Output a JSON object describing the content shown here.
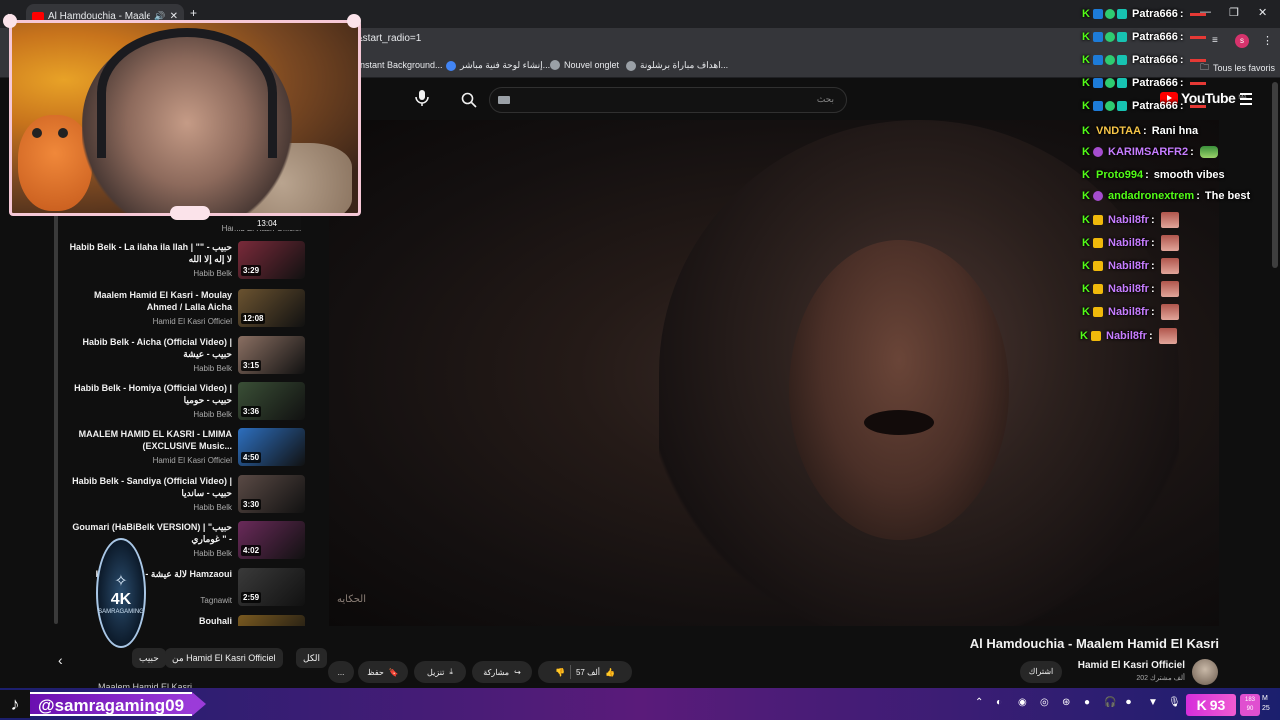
{
  "browser": {
    "tab_title": "Al Hamdouchia - Maalem H",
    "url": "&start_radio=1",
    "bookmarks": [
      {
        "label": "nstant Background..."
      },
      {
        "label": "إنشاء لوحة فنية مباشر..."
      },
      {
        "label": "Nouvel onglet"
      },
      {
        "label": "اهداف مباراة برشلونة..."
      }
    ],
    "all_favorites": "Tous les favoris",
    "profile_initial": "s"
  },
  "youtube": {
    "logo_text": "YouTube",
    "logo_region": "MA",
    "search_placeholder": "بحث"
  },
  "video": {
    "title": "Al Hamdouchia - Maalem Hamid El Kasri",
    "watermark": "الحكايه",
    "channel": "Hamid El Kasri Officiel",
    "subscribers": "202 ألف مشترك",
    "subscribe_label": "اشتراك",
    "likes": "57 ألف",
    "share_label": "مشاركة",
    "download_label": "تنزيل",
    "save_label": "حفظ",
    "more_label": "..."
  },
  "chips": {
    "c1": "الكل",
    "c2": "من Hamid El Kasri Officiel",
    "c3": "حبيب"
  },
  "playlist": {
    "first_channel": "Hamid El Kasri Officiel",
    "first_duration": "13:04",
    "items": [
      {
        "title": "Habib Belk - La ilaha ila llah | \"حبيب - \" لا إله إلا الله",
        "channel": "Habib Belk",
        "duration": "3:29",
        "color": "#7a2a3a"
      },
      {
        "title": "Maalem Hamid El Kasri - Moulay Ahmed / Lalla Aicha",
        "channel": "Hamid El Kasri Officiel",
        "duration": "12:08",
        "color": "#6b5330"
      },
      {
        "title": "Habib Belk - Aicha (Official Video) | حبيب - عيشة",
        "channel": "Habib Belk",
        "duration": "3:15",
        "color": "#8a6f62"
      },
      {
        "title": "Habib Belk - Homiya (Official Video) | حبيب - حوميا",
        "channel": "Habib Belk",
        "duration": "3:36",
        "color": "#3a4f36"
      },
      {
        "title": "MAALEM HAMID EL KASRI - LMIMA (EXCLUSIVE Music...",
        "channel": "Hamid El Kasri Officiel",
        "duration": "4:50",
        "color": "#2d6fbf"
      },
      {
        "title": "Habib Belk - Sandiya (Official Video) | حبيب - سانديا",
        "channel": "Habib Belk",
        "duration": "3:30",
        "color": "#5a4a45"
      },
      {
        "title": "Goumari (HaBiBelk VERSION) | \"حبيب - \" غوماري",
        "channel": "Habib Belk",
        "duration": "4:02",
        "color": "#6a2a5a"
      },
      {
        "title": "Lalla Aicha - لالة عيشة Hamzaoui",
        "channel": "Tagnawit",
        "duration": "2:59",
        "color": "#3a3a3a"
      },
      {
        "title": "Bouhali",
        "channel": "",
        "duration": "",
        "color": "#7a5a20"
      }
    ],
    "bottom_partial": "Maalem Hamid El Kasri"
  },
  "chat": {
    "messages": [
      {
        "user": "Patra666",
        "text": "",
        "badges": [
          "b1",
          "b2",
          "b3"
        ],
        "color": "#ffffff",
        "extra": "redbar"
      },
      {
        "user": "Patra666",
        "text": "",
        "badges": [
          "b1",
          "b2",
          "b3"
        ],
        "color": "#ffffff",
        "extra": "redbar"
      },
      {
        "user": "Patra666",
        "text": "",
        "badges": [
          "b1",
          "b2",
          "b3"
        ],
        "color": "#ffffff",
        "extra": "redbar"
      },
      {
        "user": "Patra666",
        "text": "",
        "badges": [
          "b1",
          "b2",
          "b3"
        ],
        "color": "#ffffff",
        "extra": "redbar"
      },
      {
        "user": "Patra666",
        "text": "",
        "badges": [
          "b1",
          "b2",
          "b3"
        ],
        "color": "#ffffff",
        "extra": "redbar"
      },
      {
        "user": "VNDTAA",
        "text": "Rani hna",
        "badges": [],
        "color": "#f7c548",
        "extra": ""
      },
      {
        "user": "KARIMSARFR2",
        "text": "",
        "badges": [
          "b5"
        ],
        "color": "#c77dff",
        "extra": "emoteg"
      },
      {
        "user": "Proto994",
        "text": "smooth vibes",
        "badges": [],
        "color": "#53fc18",
        "extra": ""
      },
      {
        "user": "andadronextrem",
        "text": "The best",
        "badges": [
          "b5"
        ],
        "color": "#53fc18",
        "extra": ""
      },
      {
        "user": "Nabil8fr",
        "text": "",
        "badges": [
          "b4"
        ],
        "color": "#c77dff",
        "extra": "emote"
      },
      {
        "user": "Nabil8fr",
        "text": "",
        "badges": [
          "b4"
        ],
        "color": "#c77dff",
        "extra": "emote"
      },
      {
        "user": "Nabil8fr",
        "text": "",
        "badges": [
          "b4"
        ],
        "color": "#c77dff",
        "extra": "emote"
      },
      {
        "user": "Nabil8fr",
        "text": "",
        "badges": [
          "b4"
        ],
        "color": "#c77dff",
        "extra": "emote"
      },
      {
        "user": "Nabil8fr",
        "text": "",
        "badges": [
          "b4"
        ],
        "color": "#c77dff",
        "extra": "emote"
      },
      {
        "user": "Nabil8fr",
        "text": "",
        "badges": [
          "b4"
        ],
        "color": "#c77dff",
        "extra": "emote"
      }
    ]
  },
  "stream": {
    "handle": "@samragaming09",
    "viewer_count": "93",
    "logo_text": "4K",
    "logo_sub": "SAMRAGAMING"
  },
  "tray": {
    "net_up": "183",
    "net_down": "90",
    "time_m": "M",
    "date_tail": "25"
  }
}
